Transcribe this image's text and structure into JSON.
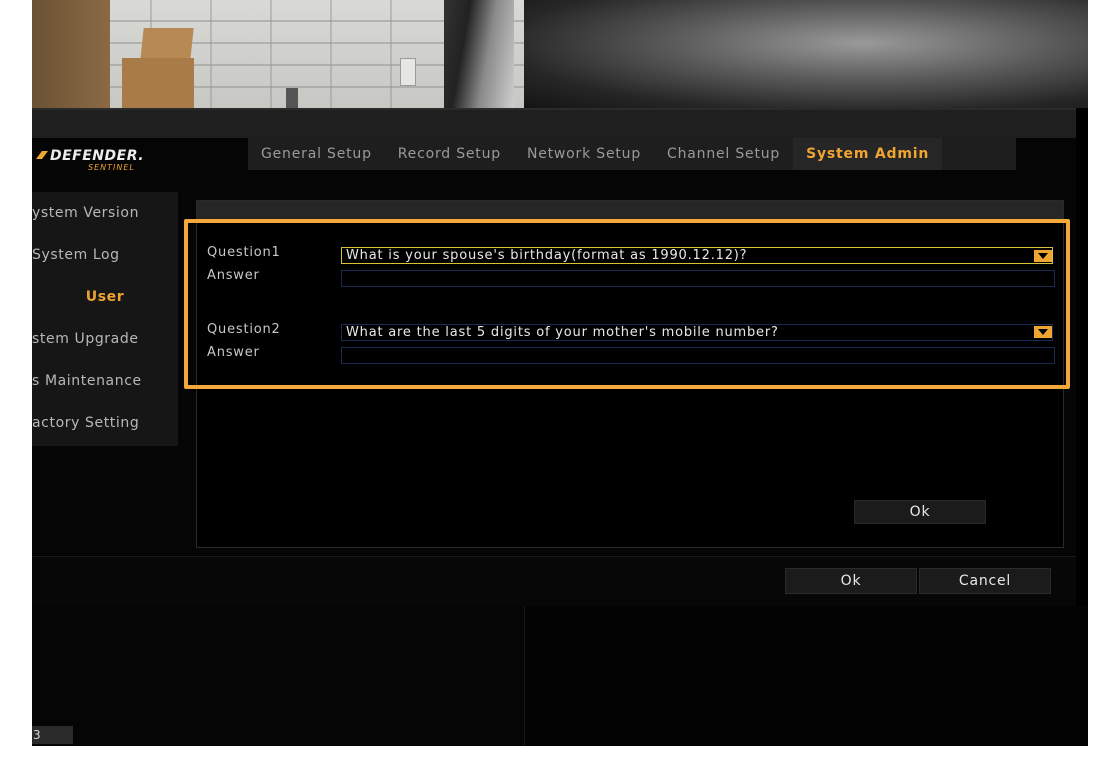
{
  "brand": {
    "name": "DEFENDER.",
    "subtitle": "SENTINEL",
    "accent": "#f0a531"
  },
  "tabs": [
    {
      "label": "General Setup",
      "active": false
    },
    {
      "label": "Record Setup",
      "active": false
    },
    {
      "label": "Network Setup",
      "active": false
    },
    {
      "label": "Channel Setup",
      "active": false
    },
    {
      "label": "System Admin",
      "active": true
    }
  ],
  "sidebar": {
    "items": [
      {
        "label": "ystem Version"
      },
      {
        "label": "System Log"
      },
      {
        "label": "User",
        "active": true
      },
      {
        "label": "stem Upgrade"
      },
      {
        "label": "s Maintenance"
      },
      {
        "label": "actory Setting"
      }
    ]
  },
  "security": {
    "question1": {
      "label": "Question1",
      "selected": "What is your spouse's birthday(format as 1990.12.12)?",
      "answer_label": "Answer",
      "answer_value": ""
    },
    "question2": {
      "label": "Question2",
      "selected": "What are the last 5 digits of your mother's mobile number?",
      "answer_label": "Answer",
      "answer_value": ""
    },
    "ok_label": "Ok"
  },
  "dialog": {
    "ok_label": "Ok",
    "cancel_label": "Cancel"
  },
  "channel_label": "3",
  "colors": {
    "highlight": "#f5a83a",
    "focus_border": "#d9c23a",
    "field_border": "#1c2a52"
  }
}
